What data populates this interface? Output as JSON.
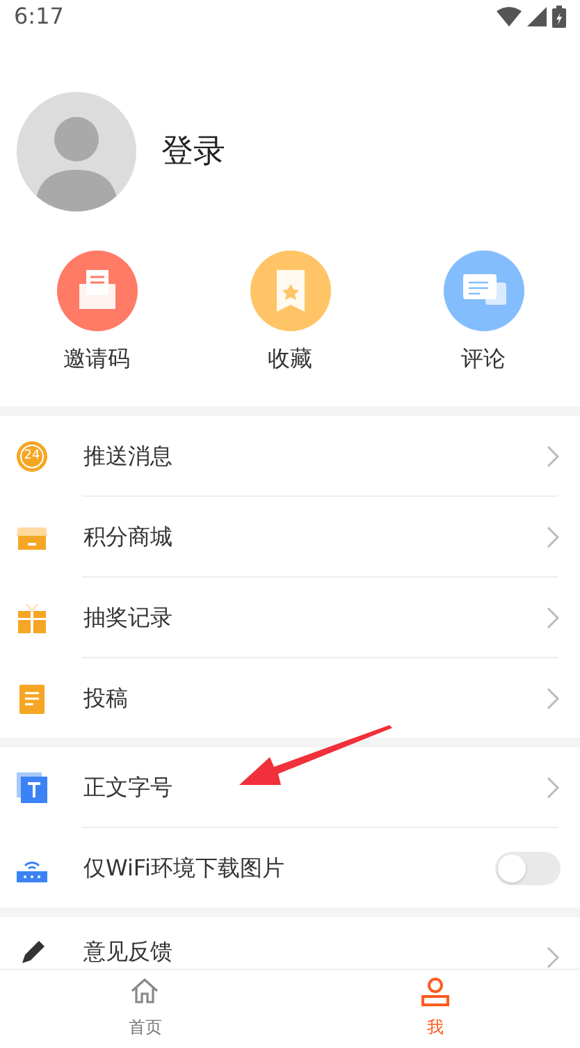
{
  "status_bar": {
    "time": "6:17"
  },
  "profile": {
    "login_label": "登录"
  },
  "shortcuts": [
    {
      "label": "邀请码",
      "color": "#ff7b66"
    },
    {
      "label": "收藏",
      "color": "#ffc466"
    },
    {
      "label": "评论",
      "color": "#84bdfd"
    }
  ],
  "menu_groups": [
    [
      {
        "kind": "link",
        "label": "推送消息",
        "icon_text": "24"
      },
      {
        "kind": "link",
        "label": "积分商城"
      },
      {
        "kind": "link",
        "label": "抽奖记录"
      },
      {
        "kind": "link",
        "label": "投稿"
      }
    ],
    [
      {
        "kind": "link",
        "label": "正文字号"
      },
      {
        "kind": "toggle",
        "label": "仅WiFi环境下载图片",
        "on": false
      }
    ],
    [
      {
        "kind": "link",
        "label": "意见反馈"
      }
    ]
  ],
  "tab_bar": [
    {
      "label": "首页",
      "selected": false
    },
    {
      "label": "我",
      "selected": true
    }
  ]
}
